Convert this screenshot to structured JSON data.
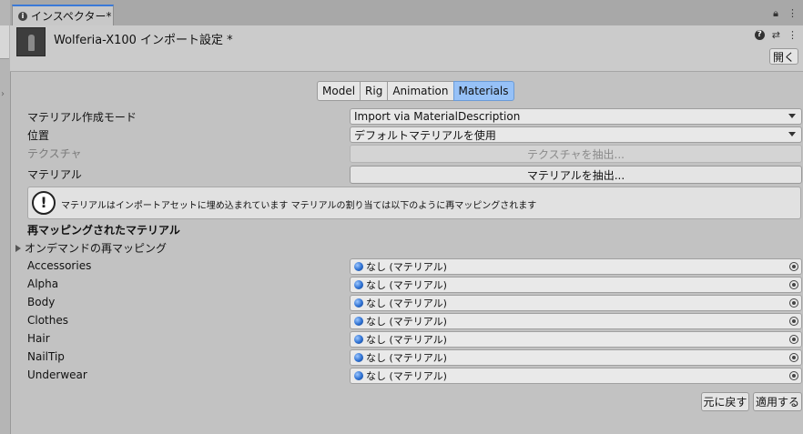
{
  "window": {
    "tab_title": "インスペクター*"
  },
  "header": {
    "title": "Wolferia-X100 インポート設定 *",
    "open_label": "開く"
  },
  "tabs": [
    {
      "label": "Model",
      "active": false
    },
    {
      "label": "Rig",
      "active": false
    },
    {
      "label": "Animation",
      "active": false
    },
    {
      "label": "Materials",
      "active": true
    }
  ],
  "settings": {
    "creation_mode": {
      "label": "マテリアル作成モード",
      "value": "Import via MaterialDescription"
    },
    "location": {
      "label": "位置",
      "value": "デフォルトマテリアルを使用"
    },
    "textures": {
      "label": "テクスチャ",
      "button": "テクスチャを抽出..."
    },
    "materials": {
      "label": "マテリアル",
      "button": "マテリアルを抽出..."
    }
  },
  "help_message": "マテリアルはインポートアセットに埋め込まれています マテリアルの割り当ては以下のように再マッピングされます",
  "remap": {
    "section_title": "再マッピングされたマテリアル",
    "on_demand_label": "オンデマンドの再マッピング",
    "items": [
      {
        "label": "Accessories",
        "value": "なし (マテリアル)"
      },
      {
        "label": "Alpha",
        "value": "なし (マテリアル)"
      },
      {
        "label": "Body",
        "value": "なし (マテリアル)"
      },
      {
        "label": "Clothes",
        "value": "なし (マテリアル)"
      },
      {
        "label": "Hair",
        "value": "なし (マテリアル)"
      },
      {
        "label": "NailTip",
        "value": "なし (マテリアル)"
      },
      {
        "label": "Underwear",
        "value": "なし (マテリアル)"
      }
    ]
  },
  "footer": {
    "revert_label": "元に戻す",
    "apply_label": "適用する"
  },
  "colors": {
    "active_tab": "#96c1f7",
    "tab_accent": "#3a79d8"
  }
}
